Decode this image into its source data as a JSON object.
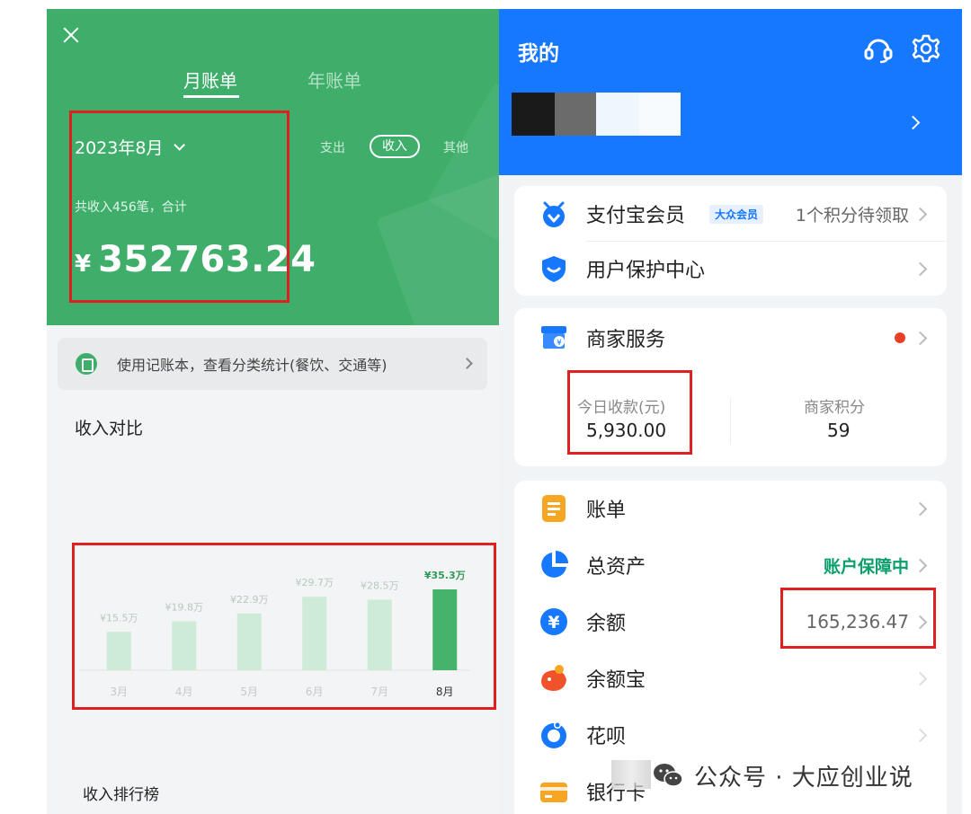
{
  "left": {
    "tabs": {
      "month": "月账单",
      "year": "年账单"
    },
    "month_selector": "2023年8月",
    "filters": {
      "expense": "支出",
      "income": "收入",
      "other": "其他"
    },
    "income_summary": "共收入456笔，合计",
    "income_total": {
      "currency": "¥",
      "amount": "352763.24"
    },
    "ledger_banner": "使用记账本，查看分类统计(餐饮、交通等)",
    "compare_title": "收入对比",
    "rank_title": "收入排行榜"
  },
  "chart_data": {
    "type": "bar",
    "title": "收入对比",
    "categories": [
      "3月",
      "4月",
      "5月",
      "6月",
      "7月",
      "8月"
    ],
    "values": [
      15.5,
      19.8,
      22.9,
      29.7,
      28.5,
      35.3
    ],
    "value_labels": [
      "¥15.5万",
      "¥19.8万",
      "¥22.9万",
      "¥29.7万",
      "¥28.5万",
      "¥35.3万"
    ],
    "unit": "万",
    "highlight_index": 5,
    "colors": {
      "normal": "#cdebd6",
      "highlight": "#45b36b",
      "label": "#b8c8bd",
      "highlight_label": "#2f9a57"
    },
    "ylim": [
      0,
      40
    ],
    "grid": false
  },
  "right": {
    "title": "我的",
    "icons": {
      "support": "headset-icon",
      "settings": "gear-icon"
    },
    "profile_blur_colors": [
      "#1a1a1a",
      "#6b6b6b",
      "#eef7fb",
      "#f7fbfd"
    ],
    "card1": {
      "vip_label": "支付宝会员",
      "vip_badge": "大众会员",
      "vip_points": "1个积分待领取",
      "protect_label": "用户保护中心"
    },
    "card2": {
      "merchant_label": "商家服务",
      "today_label": "今日收款(元)",
      "today_value": "5,930.00",
      "points_label": "商家积分",
      "points_value": "59"
    },
    "card3": {
      "bill_label": "账单",
      "assets_label": "总资产",
      "assets_status": "账户保障中",
      "balance_label": "余额",
      "balance_value": "165,236.47",
      "yuebao_label": "余额宝",
      "huabei_label": "花呗",
      "bank_label": "银行卡"
    }
  },
  "watermark": "公众号 · 大应创业说",
  "colors": {
    "green": "#3fae6b",
    "blue": "#1677ff",
    "annotation_red": "#e02020",
    "guard_green": "#0b9f6a"
  }
}
